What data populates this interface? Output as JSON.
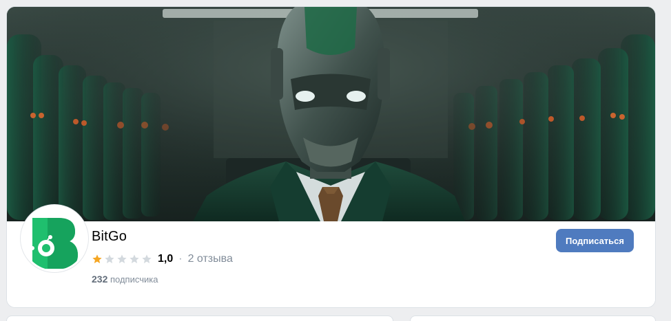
{
  "group": {
    "name": "BitGo",
    "rating": {
      "value": "1,0",
      "stars_filled": 1,
      "stars_total": 5,
      "separator": "·",
      "reviews_label": "2 отзыва"
    },
    "subscribers": {
      "count": "232",
      "label": "подписчика"
    },
    "subscribe_button": "Подписаться",
    "avatar_icon": "bitgo-logo-icon",
    "cover_image": "robot-in-suit-cover"
  },
  "colors": {
    "accent_button": "#4f7bbf",
    "star_filled": "#f5a623",
    "star_empty": "#d3d9de",
    "logo_green": "#1fbf6e"
  }
}
